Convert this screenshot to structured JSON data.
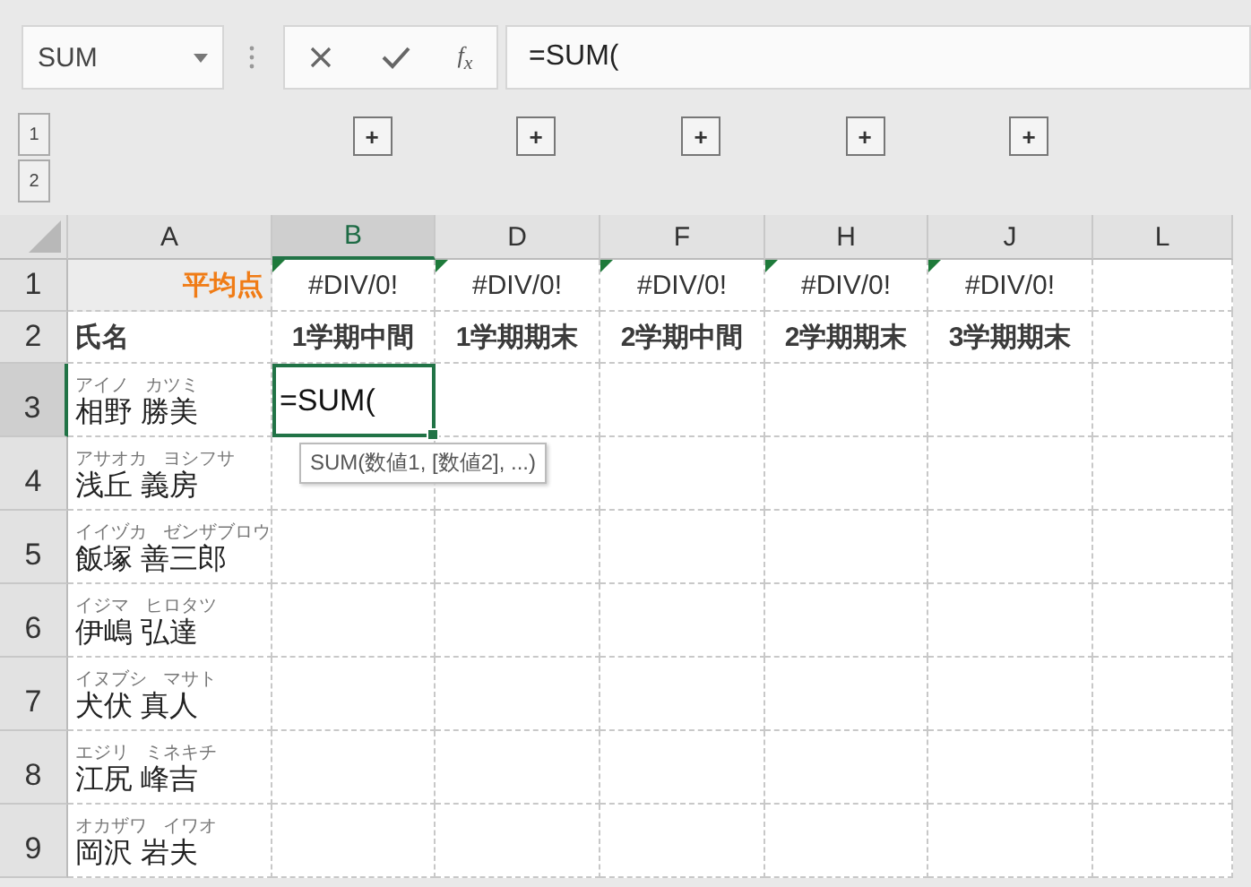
{
  "name_box": {
    "value": "SUM"
  },
  "formula_bar": {
    "function_label": "f$_{x}$",
    "value": "=SUM("
  },
  "outline": {
    "levels": [
      "1",
      "2"
    ],
    "expand_buttons": [
      "+",
      "+",
      "+",
      "+",
      "+"
    ]
  },
  "columns": [
    {
      "label": "A",
      "selected": false
    },
    {
      "label": "B",
      "selected": true
    },
    {
      "label": "D",
      "selected": false
    },
    {
      "label": "F",
      "selected": false
    },
    {
      "label": "H",
      "selected": false
    },
    {
      "label": "J",
      "selected": false
    },
    {
      "label": "L",
      "selected": false
    }
  ],
  "average_row": {
    "header": "1",
    "selected": false,
    "label": "平均点",
    "cells": [
      {
        "text": "#DIV/0!",
        "error_flag": true
      },
      {
        "text": "#DIV/0!",
        "error_flag": true
      },
      {
        "text": "#DIV/0!",
        "error_flag": true
      },
      {
        "text": "#DIV/0!",
        "error_flag": true
      },
      {
        "text": "#DIV/0!",
        "error_flag": true
      }
    ]
  },
  "heading_row": {
    "header": "2",
    "selected": false,
    "label": "氏名",
    "cells": [
      "1学期中間",
      "1学期期末",
      "2学期中間",
      "2学期期末",
      "3学期期末"
    ]
  },
  "students": [
    {
      "header": "3",
      "selected": true,
      "reading": "アイノ カツミ",
      "name": "相野 勝美",
      "entry": {
        "value": "=SUM(",
        "tooltip": "SUM(数値1, [数値2], ...)"
      }
    },
    {
      "header": "4",
      "selected": false,
      "reading": "アサオカ ヨシフサ",
      "name": "浅丘 義房"
    },
    {
      "header": "5",
      "selected": false,
      "reading": "イイヅカ ゼンザブロウ",
      "name": "飯塚 善三郎"
    },
    {
      "header": "6",
      "selected": false,
      "reading": "イジマ ヒロタツ",
      "name": "伊嶋 弘達"
    },
    {
      "header": "7",
      "selected": false,
      "reading": "イヌブシ マサト",
      "name": "犬伏 真人"
    },
    {
      "header": "8",
      "selected": false,
      "reading": "エジリ ミネキチ",
      "name": "江尻 峰吉"
    },
    {
      "header": "9",
      "selected": false,
      "reading": "オカザワ イワオ",
      "name": "岡沢 岩夫"
    }
  ]
}
